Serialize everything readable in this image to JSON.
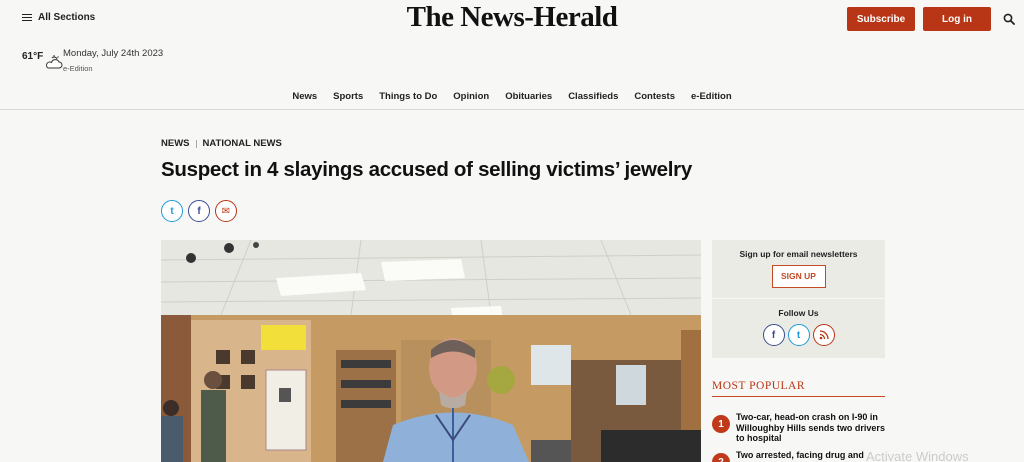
{
  "header": {
    "menu_label": "All Sections",
    "logo": "The News-Herald",
    "subscribe_label": "Subscribe",
    "login_label": "Log in",
    "weather_temp": "61°F",
    "date": "Monday, July 24th 2023",
    "eedition_link": "e-Edition"
  },
  "nav": {
    "items": [
      "News",
      "Sports",
      "Things to Do",
      "Opinion",
      "Obituaries",
      "Classifieds",
      "Contests",
      "e-Edition"
    ]
  },
  "article": {
    "breadcrumb": [
      "NEWS",
      "NATIONAL NEWS"
    ],
    "headline": "Suspect in 4 slayings accused of selling victims’ jewelry",
    "share": [
      {
        "icon": "twitter-icon",
        "glyph": "t"
      },
      {
        "icon": "facebook-icon",
        "glyph": "f"
      },
      {
        "icon": "email-icon",
        "glyph": "✉"
      }
    ]
  },
  "sidebar": {
    "newsletter_title": "Sign up for email newsletters",
    "signup_label": "SIGN UP",
    "follow_title": "Follow Us",
    "follow_icons": [
      {
        "icon": "facebook-icon",
        "glyph": "f"
      },
      {
        "icon": "twitter-icon",
        "glyph": "t"
      },
      {
        "icon": "rss-icon",
        "glyph": "⊃"
      }
    ],
    "popular_title": "MOST POPULAR",
    "popular": [
      {
        "num": "1",
        "text": "Two-car, head-on crash on I-90 in Willoughby Hills sends two drivers to hospital"
      },
      {
        "num": "2",
        "text": "Two arrested, facing drug and"
      }
    ]
  },
  "overlay": {
    "watermark": "Activate Windows"
  },
  "colors": {
    "accent": "#b83515",
    "twitter": "#1d9bd6",
    "facebook": "#3b4d8e"
  }
}
